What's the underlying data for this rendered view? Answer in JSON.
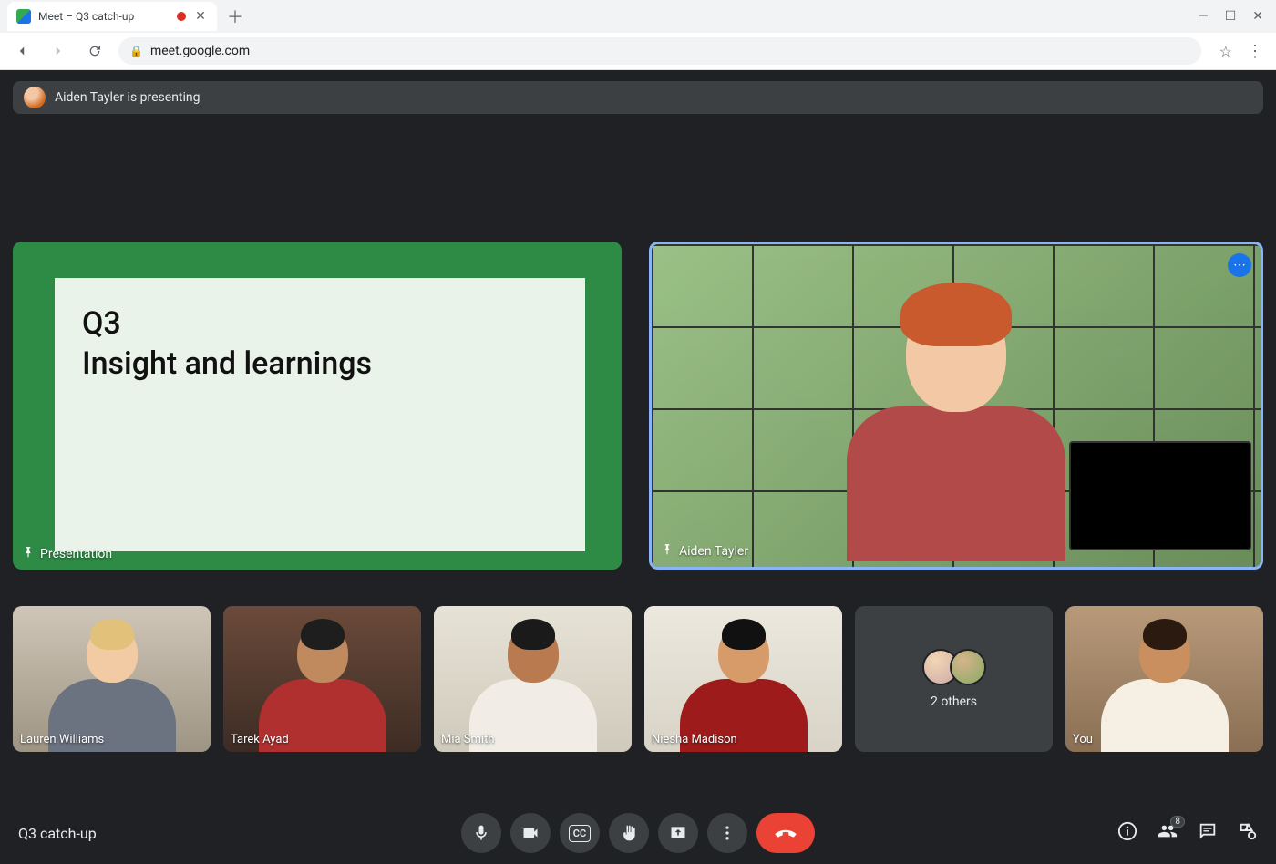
{
  "browser": {
    "tab_title": "Meet – Q3 catch-up",
    "url": "meet.google.com"
  },
  "banner": {
    "text": "Aiden Tayler is presenting"
  },
  "presentation": {
    "label": "Presentation",
    "slide_line1": "Q3",
    "slide_line2": "Insight and learnings"
  },
  "speaker": {
    "name": "Aiden Tayler"
  },
  "thumbs": [
    {
      "name": "Lauren Williams",
      "skin": "#f2cba5",
      "hair": "#e2c27a",
      "shirt": "#6b7280",
      "bg": "linear-gradient(180deg,#cfc6b8,#9e9483)"
    },
    {
      "name": "Tarek Ayad",
      "skin": "#c08a5e",
      "hair": "#1e1e1e",
      "shirt": "#b03030",
      "bg": "linear-gradient(180deg,#6b4a3a,#3d2c24)"
    },
    {
      "name": "Mia Smith",
      "skin": "#b87a4e",
      "hair": "#1a1a1a",
      "shirt": "#f1ede6",
      "bg": "linear-gradient(180deg,#e6e2d6,#cfcabb)"
    },
    {
      "name": "Niesha Madison",
      "skin": "#d79b6a",
      "hair": "#111",
      "shirt": "#9e1b1b",
      "bg": "linear-gradient(180deg,#ece8de,#d8d3c6)"
    }
  ],
  "others": {
    "label": "2 others"
  },
  "you": {
    "name": "You",
    "skin": "#c98f5f",
    "hair": "#2a1a10",
    "shirt": "#f5efe4",
    "bg": "linear-gradient(180deg,#b89a7a,#8a6f54)"
  },
  "bottom": {
    "meeting_name": "Q3 catch-up",
    "cc_label": "CC",
    "people_badge": "8"
  }
}
